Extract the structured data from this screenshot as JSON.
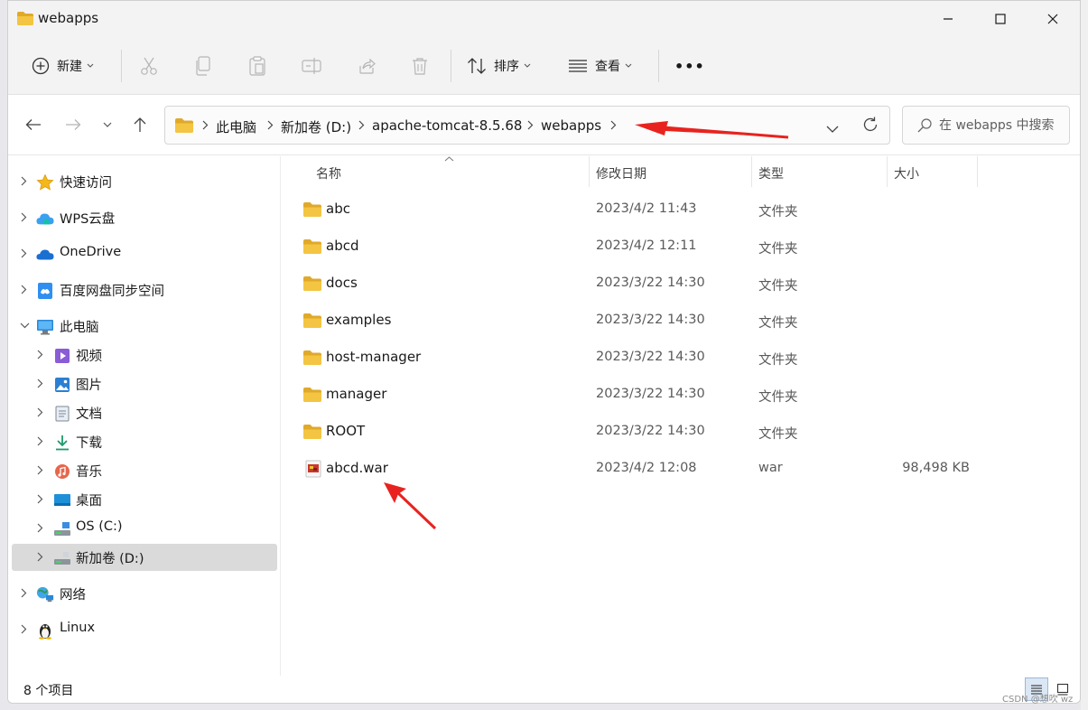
{
  "window": {
    "title": "webapps"
  },
  "toolbar": {
    "new_label": "新建",
    "sort_label": "排序",
    "view_label": "查看",
    "more_label": "•••"
  },
  "address": {
    "crumbs": [
      "此电脑",
      "新加卷 (D:)",
      "apache-tomcat-8.5.68",
      "webapps"
    ],
    "search_placeholder": "在 webapps 中搜索"
  },
  "nav": {
    "items": [
      {
        "label": "快速访问",
        "icon": "star-icon"
      },
      {
        "label": "WPS云盘",
        "icon": "wps-cloud-icon"
      },
      {
        "label": "OneDrive",
        "icon": "onedrive-cloud-icon"
      },
      {
        "label": "百度网盘同步空间",
        "icon": "baidu-netdisk-icon"
      },
      {
        "label": "此电脑",
        "icon": "computer-icon"
      },
      {
        "label": "视频",
        "icon": "video-icon"
      },
      {
        "label": "图片",
        "icon": "pictures-icon"
      },
      {
        "label": "文档",
        "icon": "documents-icon"
      },
      {
        "label": "下载",
        "icon": "download-icon"
      },
      {
        "label": "音乐",
        "icon": "music-icon"
      },
      {
        "label": "桌面",
        "icon": "desktop-icon"
      },
      {
        "label": "OS (C:)",
        "icon": "drive-icon"
      },
      {
        "label": "新加卷 (D:)",
        "icon": "drive-icon"
      },
      {
        "label": "网络",
        "icon": "network-icon"
      },
      {
        "label": "Linux",
        "icon": "linux-penguin-icon"
      }
    ]
  },
  "list": {
    "headers": {
      "name": "名称",
      "date": "修改日期",
      "type": "类型",
      "size": "大小"
    },
    "rows": [
      {
        "name": "abc",
        "date": "2023/4/2 11:43",
        "type": "文件夹",
        "size": "",
        "kind": "folder"
      },
      {
        "name": "abcd",
        "date": "2023/4/2 12:11",
        "type": "文件夹",
        "size": "",
        "kind": "folder"
      },
      {
        "name": "docs",
        "date": "2023/3/22 14:30",
        "type": "文件夹",
        "size": "",
        "kind": "folder"
      },
      {
        "name": "examples",
        "date": "2023/3/22 14:30",
        "type": "文件夹",
        "size": "",
        "kind": "folder"
      },
      {
        "name": "host-manager",
        "date": "2023/3/22 14:30",
        "type": "文件夹",
        "size": "",
        "kind": "folder"
      },
      {
        "name": "manager",
        "date": "2023/3/22 14:30",
        "type": "文件夹",
        "size": "",
        "kind": "folder"
      },
      {
        "name": "ROOT",
        "date": "2023/3/22 14:30",
        "type": "文件夹",
        "size": "",
        "kind": "folder"
      },
      {
        "name": "abcd.war",
        "date": "2023/4/2 12:08",
        "type": "war",
        "size": "98,498 KB",
        "kind": "war"
      }
    ]
  },
  "status": {
    "count": "8 个项目"
  },
  "watermark": "CSDN @想吹 wz",
  "colors": {
    "folder": "#f4c542",
    "folder_dark": "#e0a92a",
    "arrow": "#e8231f",
    "selected": "#dadada"
  }
}
